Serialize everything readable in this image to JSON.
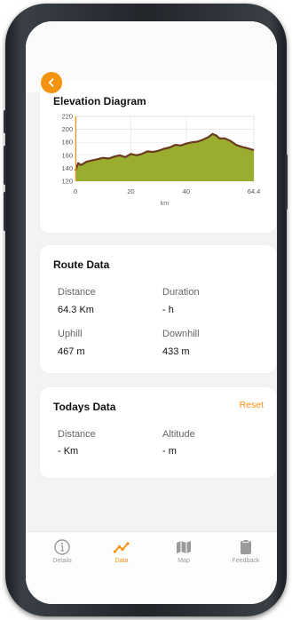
{
  "colors": {
    "accent": "#f4930f",
    "chart_fill": "#9aad2e",
    "chart_line": "#6b3a1f"
  },
  "elevation": {
    "title": "Elevation Diagram",
    "chart_data": {
      "type": "area",
      "xlabel": "km",
      "ylabel": "",
      "xlim": [
        0,
        64.4
      ],
      "ylim": [
        120,
        220
      ],
      "x_ticks": [
        0,
        20,
        40,
        64.4
      ],
      "y_ticks": [
        220,
        200,
        180,
        160,
        140,
        120
      ],
      "grid": true,
      "x": [
        0,
        1,
        2,
        4,
        6,
        8,
        10,
        12,
        14,
        16,
        18,
        20,
        22,
        24,
        26,
        28,
        30,
        32,
        34,
        36,
        38,
        40,
        42,
        44,
        46,
        48,
        49.5,
        51,
        52,
        54,
        56,
        58,
        60,
        62,
        64.4
      ],
      "y": [
        136,
        148,
        145,
        150,
        152,
        154,
        156,
        155,
        158,
        160,
        157,
        162,
        160,
        162,
        166,
        165,
        167,
        170,
        172,
        176,
        175,
        178,
        180,
        181,
        184,
        188,
        193,
        190,
        186,
        186,
        182,
        176,
        173,
        171,
        168
      ]
    }
  },
  "route": {
    "title": "Route Data",
    "distance_label": "Distance",
    "distance_value": "64.3 Km",
    "duration_label": "Duration",
    "duration_value": "- h",
    "uphill_label": "Uphill",
    "uphill_value": "467 m",
    "downhill_label": "Downhill",
    "downhill_value": "433 m"
  },
  "today": {
    "title": "Todays Data",
    "reset_label": "Reset",
    "distance_label": "Distance",
    "distance_value": "- Km",
    "altitude_label": "Altitude",
    "altitude_value": "- m"
  },
  "tabs": [
    {
      "label": "Details",
      "icon": "info-icon",
      "active": false
    },
    {
      "label": "Data",
      "icon": "line-chart-icon",
      "active": true
    },
    {
      "label": "Map",
      "icon": "map-icon",
      "active": false
    },
    {
      "label": "Feedback",
      "icon": "clipboard-icon",
      "active": false
    }
  ]
}
